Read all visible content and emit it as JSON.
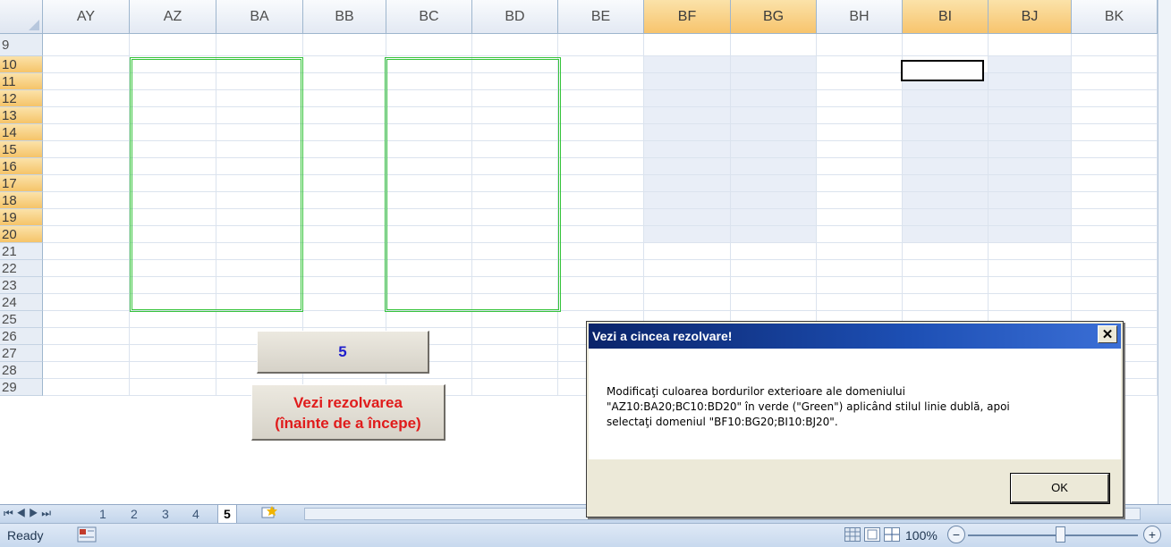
{
  "columns": [
    {
      "name": "AY",
      "selected": false
    },
    {
      "name": "AZ",
      "selected": false
    },
    {
      "name": "BA",
      "selected": false
    },
    {
      "name": "BB",
      "selected": false
    },
    {
      "name": "BC",
      "selected": false
    },
    {
      "name": "BD",
      "selected": false
    },
    {
      "name": "BE",
      "selected": false
    },
    {
      "name": "BF",
      "selected": true
    },
    {
      "name": "BG",
      "selected": true
    },
    {
      "name": "BH",
      "selected": false
    },
    {
      "name": "BI",
      "selected": true
    },
    {
      "name": "BJ",
      "selected": true
    },
    {
      "name": "BK",
      "selected": false
    }
  ],
  "rows": [
    "9",
    "10",
    "11",
    "12",
    "13",
    "14",
    "15",
    "16",
    "17",
    "18",
    "19",
    "20",
    "21",
    "22",
    "23",
    "24",
    "25",
    "26",
    "27",
    "28",
    "29"
  ],
  "selected_rows": [
    "10",
    "11",
    "12",
    "13",
    "14",
    "15",
    "16",
    "17",
    "18",
    "19",
    "20"
  ],
  "colors": {
    "border_green": "#35c33a",
    "selection_highlight": "#e9eef7",
    "header_selected": "#f7c46d"
  },
  "buttons": {
    "number_button": {
      "label": "5",
      "color": "#1f1fcc"
    },
    "solution_button": {
      "line1": "Vezi rezolvarea",
      "line2": "(înainte de a începe)",
      "color": "#e01b1b"
    }
  },
  "sheet_tabs": {
    "nav": "⏮ ◀ ▶ ⏭",
    "tabs": [
      "1",
      "2",
      "3",
      "4",
      "5"
    ],
    "active": "5",
    "insert_icon": "insert-sheet-icon"
  },
  "status": {
    "text": "Ready",
    "zoom": "100%",
    "zoom_minus": "−",
    "zoom_plus": "+"
  },
  "dialog": {
    "title": "Vezi a cincea rezolvare!",
    "close": "✕",
    "message_line1": "Modificaţi culoarea bordurilor exterioare ale domeniului",
    "message_line2": "\"AZ10:BA20;BC10:BD20\" în verde (\"Green\") aplicând stilul linie dublă, apoi",
    "message_line3": "selectaţi domeniul \"BF10:BG20;BI10:BJ20\".",
    "ok": "OK"
  }
}
